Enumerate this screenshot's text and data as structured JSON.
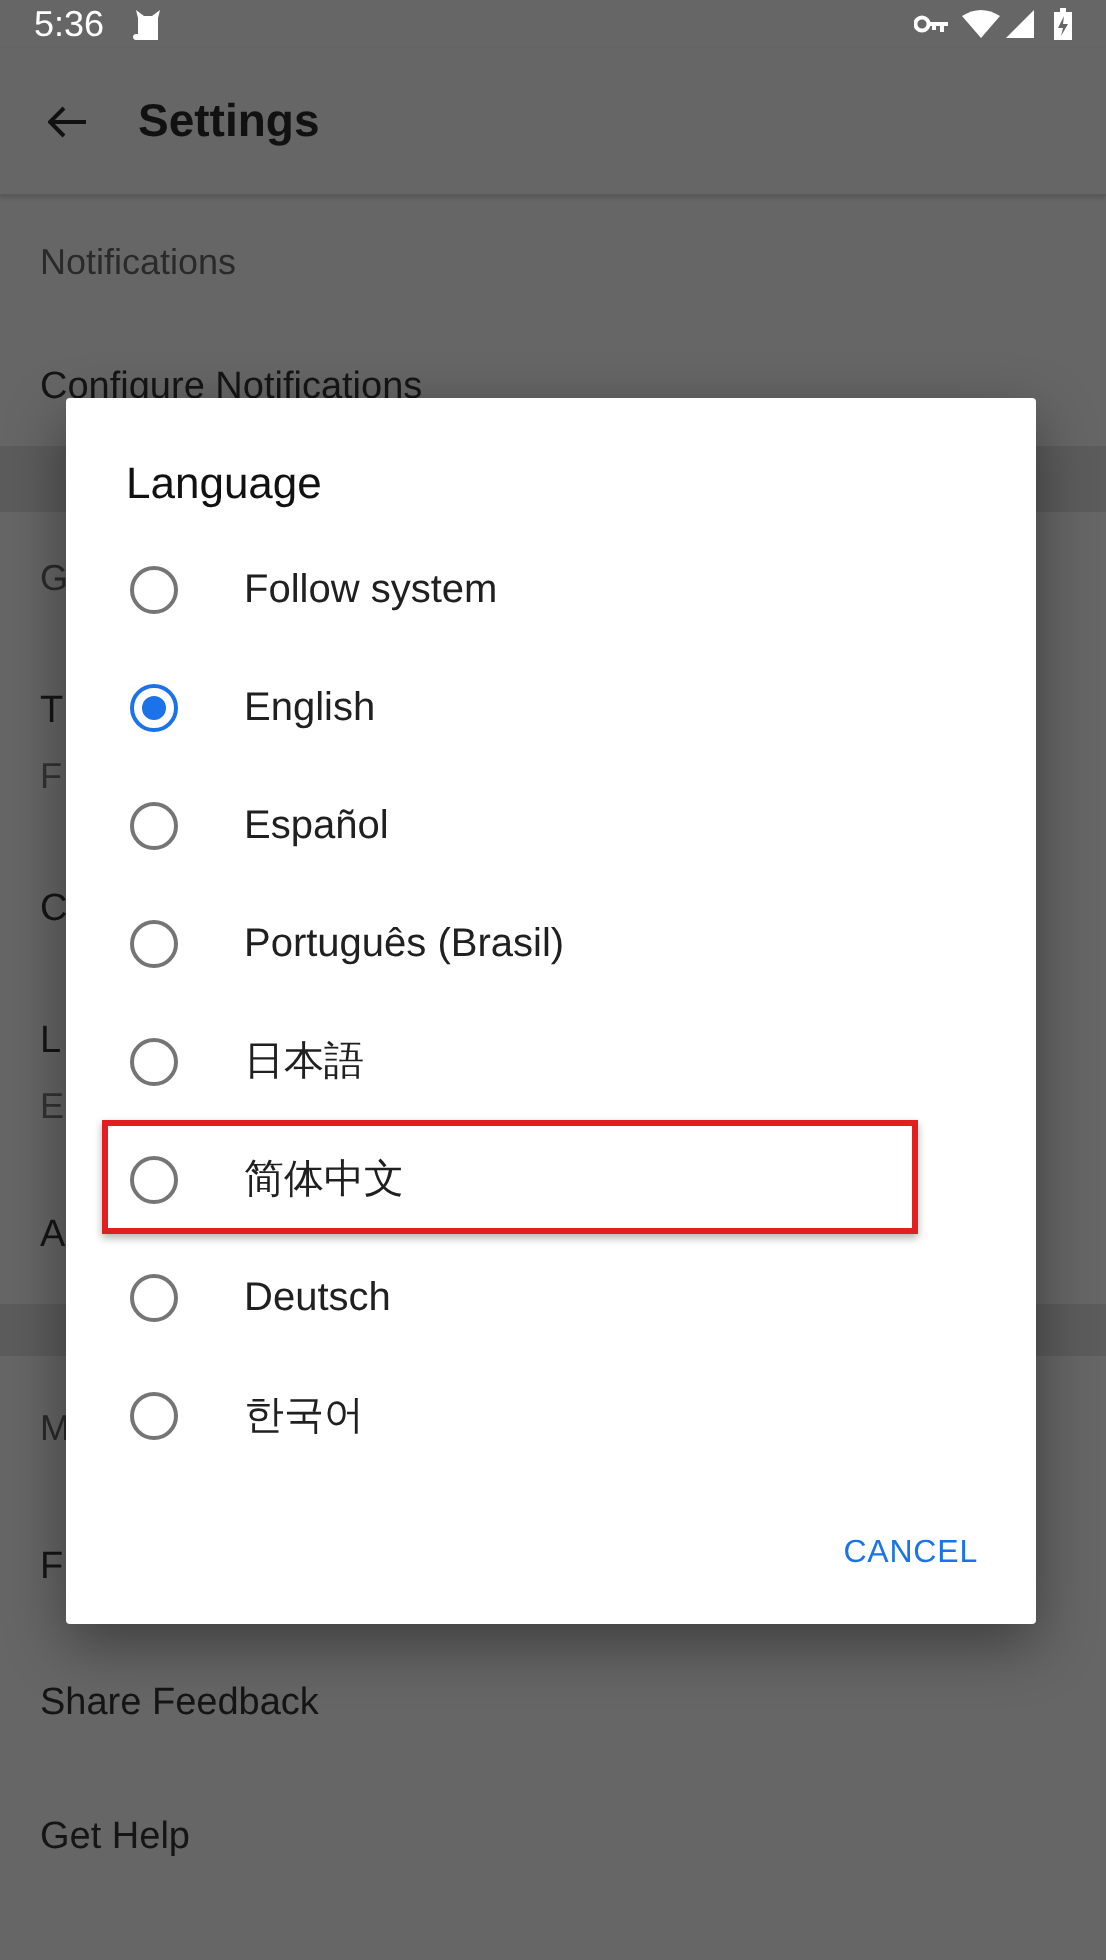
{
  "status_bar": {
    "time": "5:36"
  },
  "app_bar": {
    "title": "Settings"
  },
  "settings": [
    {
      "kind": "header",
      "label": "Notifications"
    },
    {
      "kind": "item",
      "label": "Configure Notifications"
    },
    {
      "kind": "divider"
    },
    {
      "kind": "header",
      "label": "G"
    },
    {
      "kind": "item",
      "label": "T",
      "subtitle": "F"
    },
    {
      "kind": "item",
      "label": "C"
    },
    {
      "kind": "item",
      "label": "L",
      "subtitle": "E"
    },
    {
      "kind": "item",
      "label": "A"
    },
    {
      "kind": "divider"
    },
    {
      "kind": "header",
      "label": "M"
    },
    {
      "kind": "item",
      "label": "F"
    },
    {
      "kind": "item",
      "label": "Share Feedback"
    },
    {
      "kind": "item",
      "label": "Get Help"
    }
  ],
  "dialog": {
    "title": "Language",
    "options": [
      {
        "label": "Follow system",
        "selected": false,
        "highlighted": false
      },
      {
        "label": "English",
        "selected": true,
        "highlighted": false
      },
      {
        "label": "Español",
        "selected": false,
        "highlighted": false
      },
      {
        "label": "Português (Brasil)",
        "selected": false,
        "highlighted": false
      },
      {
        "label": "日本語",
        "selected": false,
        "highlighted": false
      },
      {
        "label": "简体中文",
        "selected": false,
        "highlighted": true
      },
      {
        "label": "Deutsch",
        "selected": false,
        "highlighted": false
      },
      {
        "label": "한국어",
        "selected": false,
        "highlighted": false
      }
    ],
    "button": "CANCEL"
  }
}
